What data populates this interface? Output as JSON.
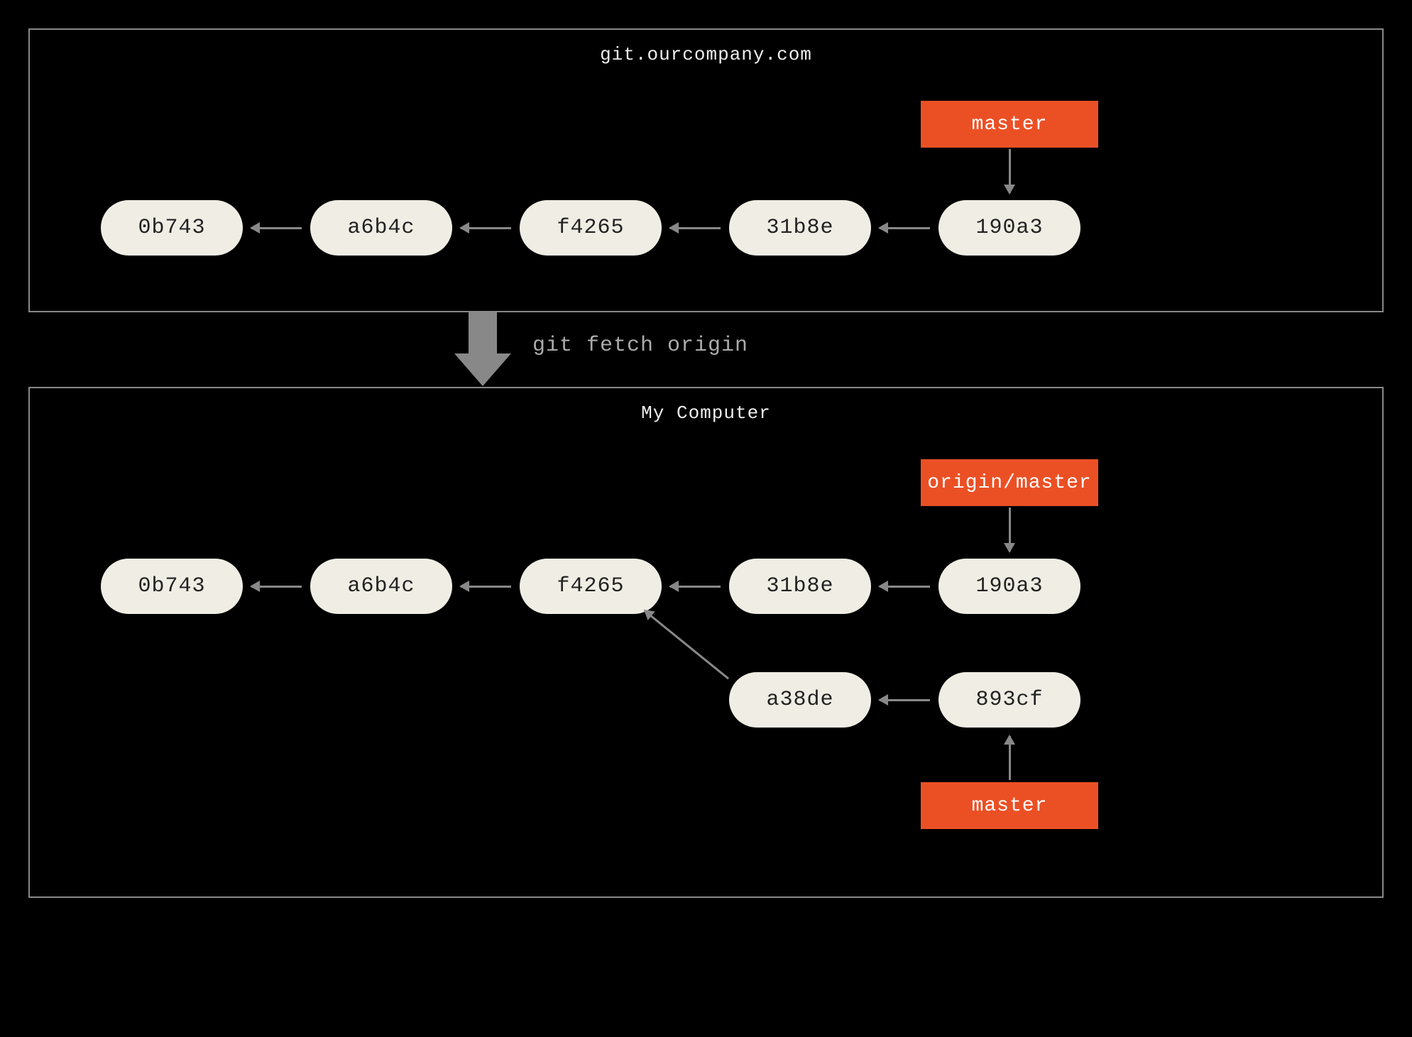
{
  "remote": {
    "title": "git.ourcompany.com",
    "branch_label": "master",
    "commits": [
      "0b743",
      "a6b4c",
      "f4265",
      "31b8e",
      "190a3"
    ]
  },
  "fetch_command": "git fetch origin",
  "local": {
    "title": "My Computer",
    "origin_master_label": "origin/master",
    "master_label": "master",
    "commits_main": [
      "0b743",
      "a6b4c",
      "f4265",
      "31b8e",
      "190a3"
    ],
    "commits_branch": [
      "a38de",
      "893cf"
    ]
  }
}
